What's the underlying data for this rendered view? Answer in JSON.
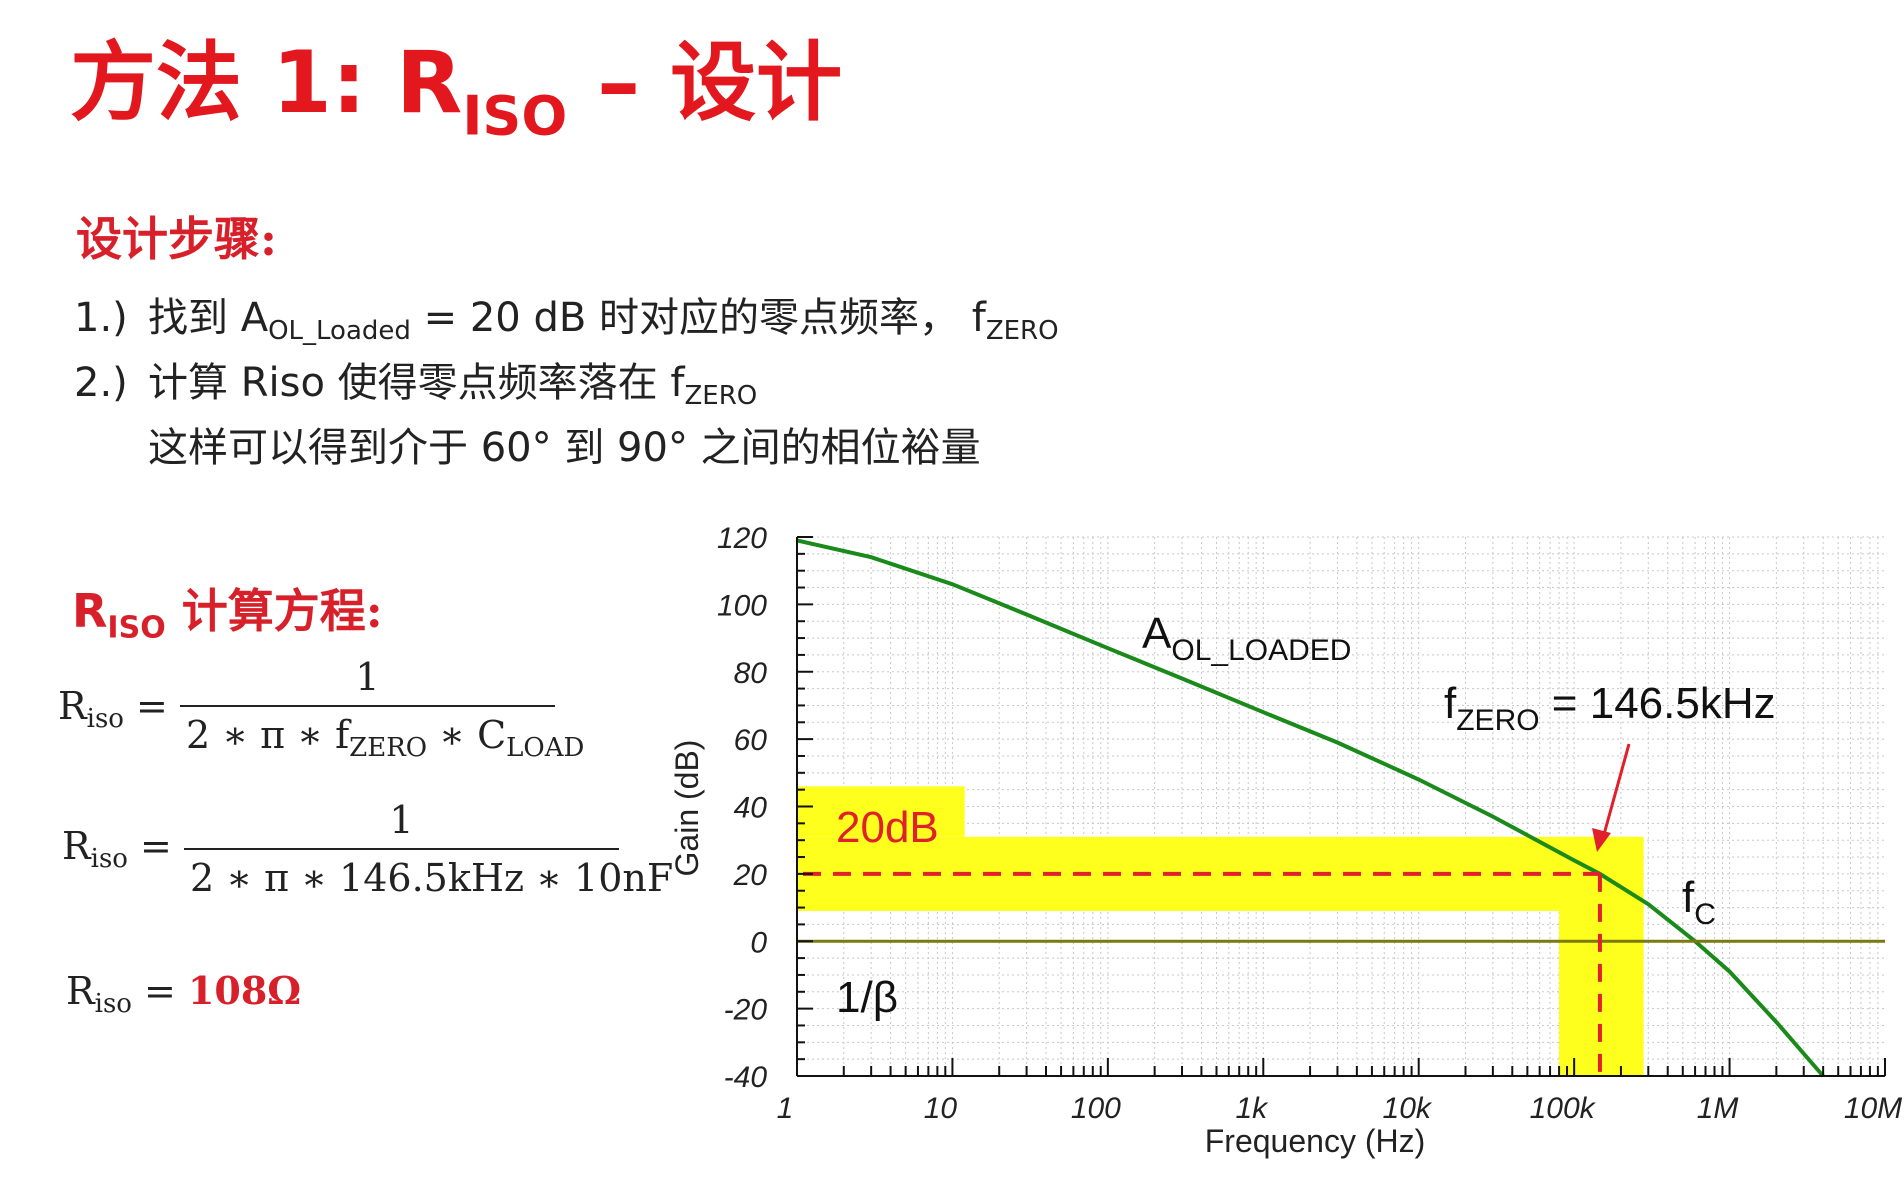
{
  "title": {
    "main": "方法 1: R",
    "sub": "ISO",
    "tail": " – 设计"
  },
  "design_steps": {
    "heading": "设计步骤:",
    "step1": {
      "num": "1.)",
      "pre": "找到 A",
      "sub1": "OL_Loaded",
      "mid": " = 20 dB 时对应的零点频率，  f",
      "sub2": "ZERO"
    },
    "step2": {
      "num": "2.)",
      "pre": "计算 Riso 使得零点频率落在 f",
      "sub": "ZERO"
    },
    "step3": {
      "text": "这样可以得到介于 60° 到 90° 之间的相位裕量"
    }
  },
  "equations": {
    "heading_r": "R",
    "heading_sub": "ISO",
    "heading_tail": " 计算方程:",
    "lhs_r": "R",
    "lhs_sub": "iso",
    "eq1": {
      "numerator": "1",
      "den_pre": "2 ∗ π ∗ f",
      "den_sub1": "ZERO",
      "den_mid": " ∗ C",
      "den_sub2": "LOAD"
    },
    "eq2": {
      "numerator": "1",
      "denominator": "2 ∗ π ∗ 146.5kHz ∗ 10nF"
    },
    "eq3": {
      "result": "108Ω"
    }
  },
  "chart_data": {
    "type": "line",
    "xlabel": "Frequency (Hz)",
    "ylabel": "Gain (dB)",
    "x_scale": "log",
    "xlim": [
      1,
      10000000
    ],
    "ylim": [
      -40,
      120
    ],
    "x_ticks": [
      1,
      10,
      100,
      1000,
      10000,
      100000,
      1000000,
      10000000
    ],
    "x_tick_labels": [
      "1",
      "10",
      "100",
      "1k",
      "10k",
      "100k",
      "1M",
      "10M"
    ],
    "y_ticks": [
      -40,
      -20,
      0,
      20,
      40,
      60,
      80,
      100,
      120
    ],
    "y_tick_labels": [
      "-40",
      "-20",
      "0",
      "20",
      "40",
      "60",
      "80",
      "100",
      "120"
    ],
    "grid": true,
    "series": [
      {
        "name": "A_OL_LOADED",
        "color": "#1a8a1a",
        "x": [
          1,
          3,
          10,
          30,
          100,
          300,
          1000,
          3000,
          10000,
          30000,
          100000,
          146500,
          300000,
          600000,
          1000000,
          2000000,
          4000000
        ],
        "y": [
          119,
          114,
          106,
          97,
          87,
          78,
          68,
          59,
          48,
          37,
          24,
          20,
          11,
          0,
          -9,
          -24,
          -40
        ]
      },
      {
        "name": "1/β",
        "color": "#7a7a10",
        "x": [
          1,
          10000000
        ],
        "y": [
          0,
          0
        ]
      }
    ],
    "highlight": {
      "color": "#ffff1e",
      "hband": {
        "x": [
          1,
          250000
        ],
        "y": [
          9,
          31
        ]
      },
      "hblock": {
        "x": [
          1,
          12
        ],
        "y": [
          31,
          46
        ]
      },
      "vband": {
        "x": [
          80000,
          280000
        ],
        "y": [
          -40,
          31
        ]
      }
    },
    "zero_marker": {
      "x": 146500,
      "y": 20,
      "color": "#e0202a"
    },
    "annotations": {
      "aol_main": "A",
      "aol_sub": "OL_LOADED",
      "fzero_main": "f",
      "fzero_sub": "ZERO",
      "fzero_tail": " = 146.5kHz",
      "fc_main": "f",
      "fc_sub": "C",
      "beta": "1/β",
      "db20": "20dB"
    }
  }
}
